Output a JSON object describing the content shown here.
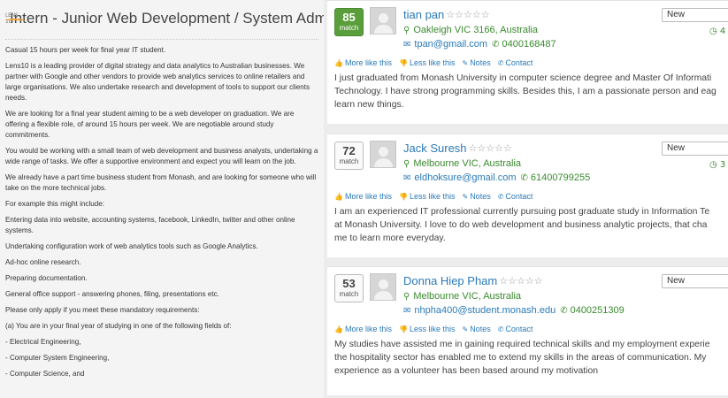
{
  "job": {
    "logo_text": "LENS 10",
    "title": "Intern - Junior Web Development / System Admin",
    "paragraphs": [
      "Casual 15 hours per week for final year IT student.",
      "Lens10 is a leading provider of digital strategy and data analytics to Australian businesses. We partner with Google and other vendors to provide web analytics services to online retailers and large organisations. We also undertake research and development of tools to support our clients needs.",
      "We are looking for a final year student aiming to be a web developer on graduation. We are offering a flexible role, of around 15 hours per week.  We are negotiable around study commitments.",
      "You would be working with a small team of web development and business analysts, undertaking a wide range of tasks.  We offer a supportive environment and expect you will learn on the job.",
      "We already have a part time business student from Monash, and are looking for someone who will take on the more technical jobs.",
      "For example this might include:",
      "Entering data into website, accounting systems, facebook, LinkedIn, twitter and other online systems.",
      "Undertaking configuration work of web analytics tools such as Google Analytics.",
      "Ad-hoc online research.",
      "Preparing documentation.",
      "General office support - answering phones, filing, presentations etc.",
      "Please only apply if you meet these mandatory requirements:",
      "(a) You are in your final year of studying in one of the following fields of:",
      "- Electrical Engineering,",
      "- Computer System Engineering,",
      "- Computer Science,  and"
    ]
  },
  "actions": {
    "more": "More like this",
    "less": "Less like this",
    "notes": "Notes",
    "contact": "Contact"
  },
  "candidates": [
    {
      "match": "85",
      "match_label": "match",
      "name": "tian pan",
      "stars": "☆☆☆☆☆",
      "location": "Oakleigh VIC 3166, Australia",
      "email": "tpan@gmail.com",
      "phone": "0400168487",
      "status": "New",
      "days": "4",
      "summary_lines": [
        "I just graduated from Monash University in computer science degree and Master Of Informati",
        "Technology. I have strong programming skills. Besides this, I am a passionate person and eag",
        "learn new things."
      ]
    },
    {
      "match": "72",
      "match_label": "match",
      "name": "Jack Suresh",
      "stars": "☆☆☆☆☆",
      "location": "Melbourne VIC, Australia",
      "email": "eldhoksure@gmail.com",
      "phone": "61400799255",
      "status": "New",
      "days": "3",
      "summary_lines": [
        "I am an experienced IT professional currently pursuing post graduate study in Information Te",
        "at Monash University. I love to do web development and business analytic projects, that cha",
        "me to learn more everyday."
      ]
    },
    {
      "match": "53",
      "match_label": "match",
      "name": "Donna Hiep Pham",
      "stars": "☆☆☆☆☆",
      "location": "Melbourne VIC, Australia",
      "email": "nhpha400@student.monash.edu",
      "phone": "0400251309",
      "status": "New",
      "days": "",
      "summary_lines": [
        "My studies have assisted me in gaining required technical skills and my employment experie",
        "the hospitality sector has enabled me to extend my skills in the areas of communication. My",
        "experience as a volunteer has been based around my motivation"
      ]
    }
  ],
  "colors": {
    "top_match": "#5a9e3c",
    "link": "#2a7ab8",
    "green": "#3a8a2e"
  }
}
